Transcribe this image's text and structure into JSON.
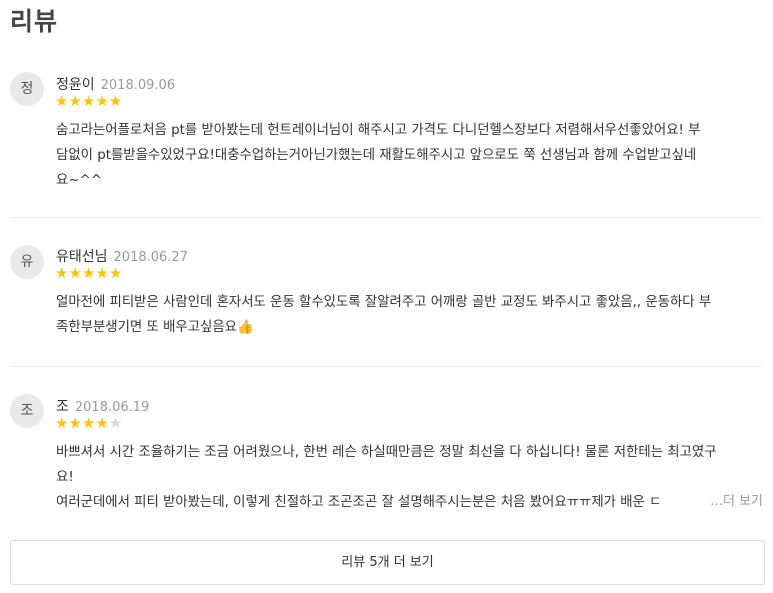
{
  "section": {
    "title": "리뷰"
  },
  "reviews": [
    {
      "avatar": "정",
      "name": "정윤이",
      "date": "2018.09.06",
      "rating": 5,
      "lines": [
        "숨고라는어플로처음 pt를 받아봤는데 헌트레이너님이 해주시고 가격도 다니던헬스장보다 저렴해서우선좋았어요! 부",
        "담없이 pt를받을수있었구요!대충수업하는거아닌가했는데 재활도해주시고 앞으로도 쭉 선생님과 함께 수업받고싶네",
        "요~^^"
      ]
    },
    {
      "avatar": "유",
      "name": "유태선님",
      "date": "2018.06.27",
      "rating": 5,
      "lines": [
        "얼마전에 피티받은 사람인데 혼자서도 운동 할수있도록 잘알려주고 어깨랑 골반 교정도 봐주시고 좋았음,, 운동하다 부",
        "족한부분생기면 또 배우고싶음요👍"
      ]
    },
    {
      "avatar": "조",
      "name": "조",
      "date": "2018.06.19",
      "rating": 4,
      "lines": [
        "바쁘셔서 시간 조율하기는 조금 어려웠으나, 한번 레슨 하실때만큼은 정말 최선을 다 하십니다! 물론 저한테는 최고였구",
        "요!",
        "여러군데에서 피티 받아봤는데, 이렇게 친절하고 조곤조곤 잘 설명해주시는분은 처음 봤어요ㅠㅠ제가 배운 ㄷ"
      ],
      "more_label": "…더 보기"
    }
  ],
  "footer": {
    "more_reviews_label": "리뷰 5개 더 보기"
  },
  "colors": {
    "star_on": "#ffc400",
    "star_off": "#d9d9d9",
    "avatar_bg": "#e9e9e9"
  }
}
